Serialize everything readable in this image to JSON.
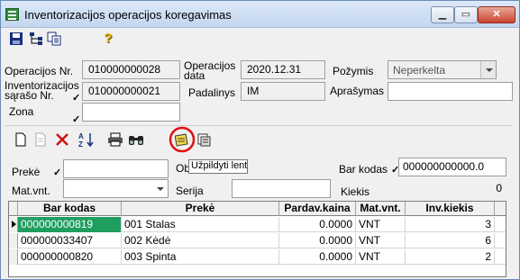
{
  "window": {
    "title": "Inventorizacijos operacijos koregavimas",
    "min_symbol": "▁",
    "max_symbol": "▭",
    "close_symbol": "✕"
  },
  "toolbar_top": [
    {
      "name": "save-icon"
    },
    {
      "name": "tree-icon"
    },
    {
      "name": "copy-icon"
    },
    {
      "name": "help-icon",
      "glyph": "?"
    }
  ],
  "form": {
    "operacijos_nr_label": "Operacijos Nr.",
    "operacijos_nr_value": "010000000028",
    "operacijos_data_label": "Operacijos data",
    "operacijos_data_value": "2020.12.31",
    "pozymis_label": "Požymis",
    "pozymis_value": "Neperkelta",
    "inv_saraso_nr_label": "Inventorizacijos sąrašo Nr.",
    "inv_saraso_nr_value": "010000000021",
    "padalinys_label": "Padalinys",
    "padalinys_value": "IM",
    "aprasymas_label": "Aprašymas",
    "aprasymas_value": "",
    "zona_label": "Zona",
    "zona_value": "",
    "check_mark": "✓"
  },
  "toolbar_grid": [
    {
      "name": "new-icon"
    },
    {
      "name": "edit-icon"
    },
    {
      "name": "delete-icon"
    },
    {
      "name": "sort-icon"
    },
    {
      "name": "print-icon"
    },
    {
      "name": "find-icon"
    },
    {
      "name": "fill-table-icon"
    },
    {
      "name": "print-report-icon"
    }
  ],
  "filters": {
    "preke_label": "Prekė",
    "preke_value": "",
    "matvnt_label": "Mat.vnt.",
    "matvnt_value": "",
    "ob_label": "Ob",
    "serija_label": "Serija",
    "serija_value": "",
    "barkodas_label": "Bar kodas",
    "barkodas_value": "000000000000.0",
    "kiekis_label": "Kiekis",
    "kiekis_value": "0"
  },
  "tooltip": {
    "text": "Užpildyti lentelę"
  },
  "table": {
    "columns": [
      "Bar kodas",
      "Prekė",
      "Pardav.kaina",
      "Mat.vnt.",
      "Inv.kiekis"
    ],
    "rows": [
      {
        "bar": "000000000819",
        "preke": "001  Stalas",
        "kaina": "0.0000",
        "vnt": "VNT",
        "kiekis": "3"
      },
      {
        "bar": "000000033407",
        "preke": "002  Kėdė",
        "kaina": "0.0000",
        "vnt": "VNT",
        "kiekis": "6"
      },
      {
        "bar": "000000000820",
        "preke": "003  Spinta",
        "kaina": "0.0000",
        "vnt": "VNT",
        "kiekis": "2"
      }
    ]
  },
  "colors": {
    "selected_cell": "#1f9e5f",
    "highlight_circle": "#e01010"
  }
}
